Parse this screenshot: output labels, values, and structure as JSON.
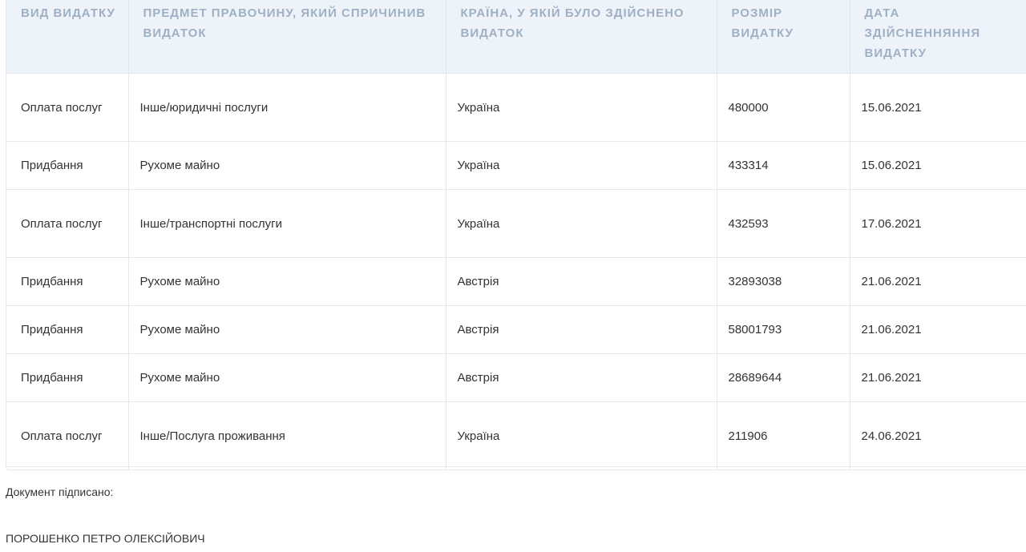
{
  "table": {
    "headers": [
      "ВИД ВИДАТКУ",
      "ПРЕДМЕТ ПРАВОЧИНУ, ЯКИЙ СПРИЧИНИВ ВИДАТОК",
      "КРАЇНА, У ЯКІЙ БУЛО ЗДІЙСНЕНО ВИДАТОК",
      "РОЗМІР ВИДАТКУ",
      "ДАТА ЗДІЙСНЕННЯННЯ ВИДАТКУ"
    ],
    "rows": [
      [
        "Оплата послуг",
        "Інше/юридичні послуги",
        "Україна",
        "480000",
        "15.06.2021"
      ],
      [
        "Придбання",
        "Рухоме майно",
        "Україна",
        "433314",
        "15.06.2021"
      ],
      [
        "Оплата послуг",
        "Інше/транспортні послуги",
        "Україна",
        "432593",
        "17.06.2021"
      ],
      [
        "Придбання",
        "Рухоме майно",
        "Австрія",
        "32893038",
        "21.06.2021"
      ],
      [
        "Придбання",
        "Рухоме майно",
        "Австрія",
        "58001793",
        "21.06.2021"
      ],
      [
        "Придбання",
        "Рухоме майно",
        "Австрія",
        "28689644",
        "21.06.2021"
      ],
      [
        "Оплата послуг",
        "Інше/Послуга проживання",
        "Україна",
        "211906",
        "24.06.2021"
      ]
    ]
  },
  "footer": {
    "signed_label": "Документ підписано:",
    "signer_name": "ПОРОШЕНКО ПЕТРО ОЛЕКСІЙОВИЧ"
  },
  "colors": {
    "header_bg": "#eef3f9",
    "header_text": "#9fb0c4",
    "border": "#e3e8ee",
    "body_text": "#333333"
  }
}
